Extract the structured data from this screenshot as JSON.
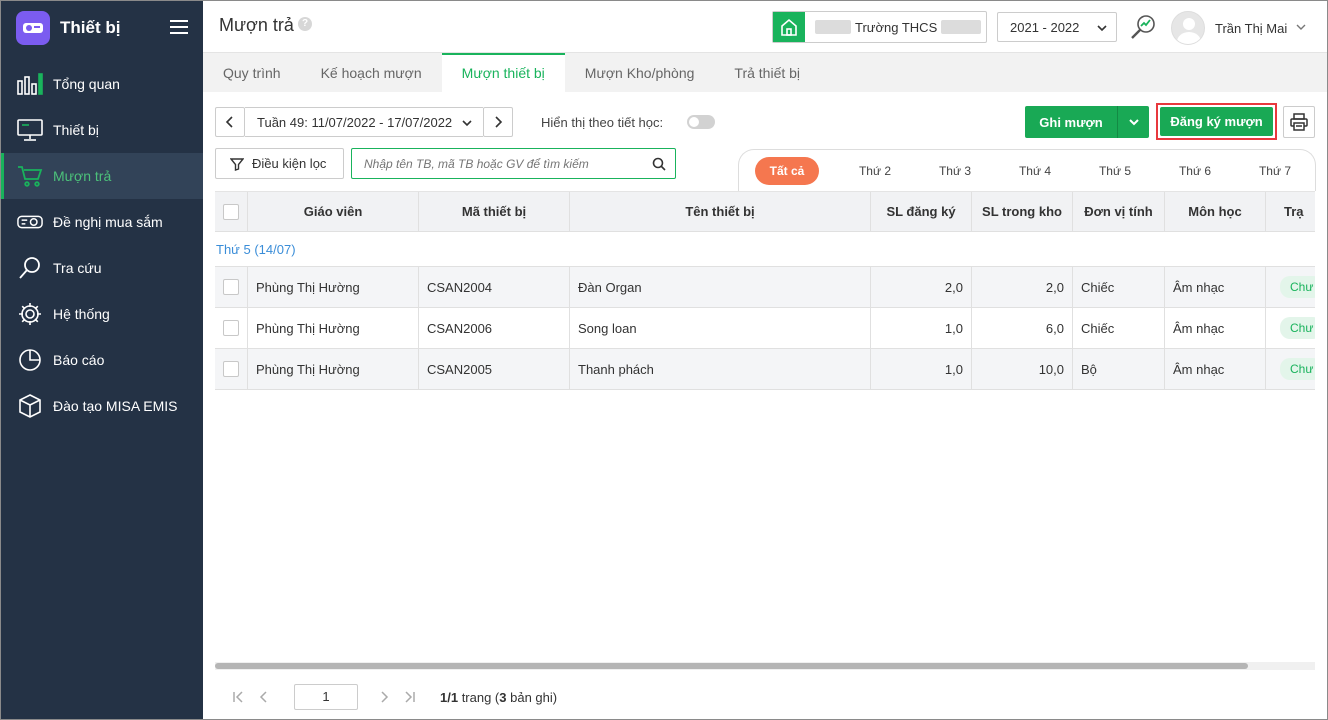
{
  "sidebar": {
    "title": "Thiết bị",
    "items": [
      {
        "label": "Tổng quan",
        "icon": "dashboard-icon"
      },
      {
        "label": "Thiết bị",
        "icon": "monitor-icon"
      },
      {
        "label": "Mượn trả",
        "icon": "cart-icon",
        "active": true
      },
      {
        "label": "Đề nghị mua sắm",
        "icon": "projector-icon"
      },
      {
        "label": "Tra cứu",
        "icon": "search-icon"
      },
      {
        "label": "Hệ thống",
        "icon": "gear-icon"
      },
      {
        "label": "Báo cáo",
        "icon": "pie-chart-icon"
      },
      {
        "label": "Đào tạo MISA EMIS",
        "icon": "box-icon"
      }
    ]
  },
  "header": {
    "title": "Mượn trả",
    "help": "?",
    "school_name": "Trường THCS",
    "year": "2021 - 2022",
    "user_name": "Trần Thị Mai"
  },
  "tabs": [
    "Quy trình",
    "Kế hoạch mượn",
    "Mượn thiết bị",
    "Mượn Kho/phòng",
    "Trả thiết bị"
  ],
  "toolbar": {
    "week_range": "Tuần 49: 11/07/2022 - 17/07/2022",
    "toggle_label": "Hiển thị theo tiết học:",
    "record_button": "Ghi mượn",
    "register_button": "Đăng ký mượn",
    "filter_button": "Điều kiện lọc",
    "search_placeholder": "Nhập tên TB, mã TB hoặc GV để tìm kiếm"
  },
  "day_filters": [
    "Tất cả",
    "Thứ 2",
    "Thứ 3",
    "Thứ 4",
    "Thứ 5",
    "Thứ 6",
    "Thứ 7"
  ],
  "table": {
    "headers": [
      "Giáo viên",
      "Mã thiết bị",
      "Tên thiết bị",
      "SL đăng ký",
      "SL trong kho",
      "Đơn vị tính",
      "Môn học",
      "Trạ"
    ],
    "group_label": "Thứ 5 (14/07)",
    "rows": [
      {
        "teacher": "Phùng Thị Hường",
        "code": "CSAN2004",
        "name": "Đàn Organ",
        "qty_reg": "2,0",
        "qty_stock": "2,0",
        "unit": "Chiếc",
        "subject": "Âm nhạc",
        "status": "Chư"
      },
      {
        "teacher": "Phùng Thị Hường",
        "code": "CSAN2006",
        "name": "Song loan",
        "qty_reg": "1,0",
        "qty_stock": "6,0",
        "unit": "Chiếc",
        "subject": "Âm nhạc",
        "status": "Chư"
      },
      {
        "teacher": "Phùng Thị Hường",
        "code": "CSAN2005",
        "name": "Thanh phách",
        "qty_reg": "1,0",
        "qty_stock": "10,0",
        "unit": "Bộ",
        "subject": "Âm nhạc",
        "status": "Chư"
      }
    ]
  },
  "pager": {
    "page": "1",
    "pages": "1/1",
    "trang": " trang (",
    "count": "3",
    "suffix": " bản ghi)"
  },
  "colors": {
    "sidebar_bg": "#243245",
    "accent_green": "#19b35c",
    "day_all": "#f5774f",
    "highlight_border": "#e8383d"
  }
}
